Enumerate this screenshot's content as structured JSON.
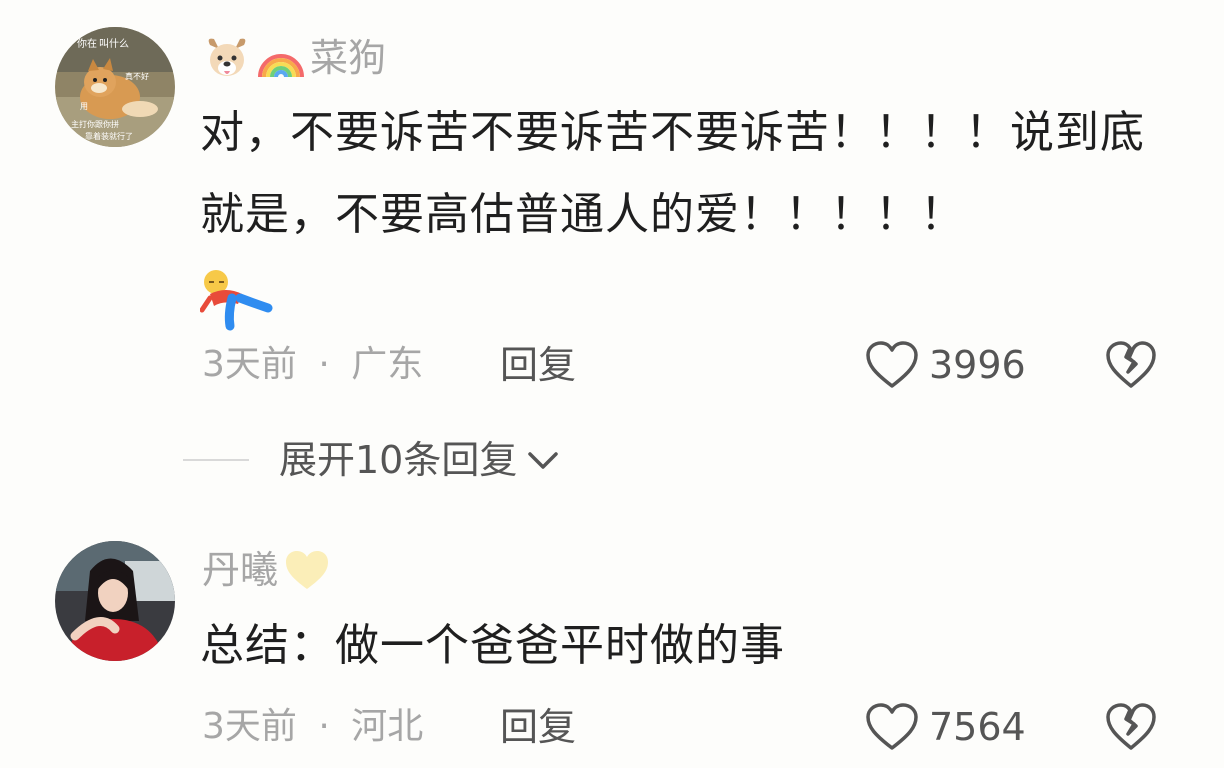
{
  "comments": [
    {
      "username": "菜狗",
      "username_emojis": [
        "dog-face-emoji",
        "rainbow-emoji"
      ],
      "text": "对，不要诉苦不要诉苦不要诉苦！！！！说到底就是，不要高估普通人的爱！！！！！",
      "trailing_sticker": "lying-down-emoji",
      "time": "3天前",
      "separator": "·",
      "location": "广东",
      "reply_label": "回复",
      "likes": "3996",
      "avatar": {
        "icon": "shiba-dog-avatar",
        "overlay_text": [
          "你在",
          "叫什么",
          "真不好",
          "用",
          "主打你跟你拼",
          "靠着装就行了"
        ]
      }
    },
    {
      "username": "丹曦",
      "username_emojis": [
        "yellow-heart-emoji"
      ],
      "text": "总结：做一个爸爸平时做的事",
      "time": "3天前",
      "separator": "·",
      "location": "河北",
      "reply_label": "回复",
      "likes": "7564",
      "avatar": {
        "icon": "woman-portrait-avatar"
      }
    }
  ],
  "expand_replies": {
    "label": "展开10条回复",
    "icon": "chevron-down-icon"
  },
  "icons": {
    "like": "heart-outline-icon",
    "dislike": "broken-heart-icon"
  },
  "colors": {
    "background": "#fdfdfb",
    "text_primary": "#1f1f1f",
    "text_secondary": "#a6a6a6",
    "action_text": "#555555"
  }
}
